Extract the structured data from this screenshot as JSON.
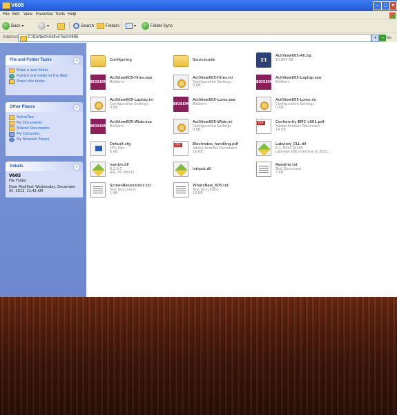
{
  "window": {
    "title": "V605"
  },
  "menu": [
    "File",
    "Edit",
    "View",
    "Favorites",
    "Tools",
    "Help"
  ],
  "toolbar": {
    "back": "Back",
    "search": "Search",
    "folders": "Folders",
    "folder_sync": "Folder Sync"
  },
  "address": {
    "label": "Address",
    "path": "C:\\Cortech\\ActiveTwo\\V605",
    "go": "Go"
  },
  "file_tasks": {
    "title": "File and Folder Tasks",
    "items": [
      "Make a new folder",
      "Publish this folder to the Web",
      "Share this folder"
    ]
  },
  "other_places": {
    "title": "Other Places",
    "items": [
      "ActiveTwo",
      "My Documents",
      "Shared Documents",
      "My Computer",
      "My Network Places"
    ]
  },
  "details": {
    "title": "Details",
    "name": "V605",
    "type": "File Folder",
    "modified": "Date Modified: Wednesday, December 05, 2012, 11:42 AM"
  },
  "files": [
    {
      "name": "Configuring",
      "kind": "folder"
    },
    {
      "name": "Sourcecode",
      "kind": "folder"
    },
    {
      "name": "ActiView605-All.zip",
      "kind": "zip",
      "line2": "10,894 KB"
    },
    {
      "name": "ActiView605-Hires.exe",
      "kind": "biosemi",
      "line2": "BioSemi"
    },
    {
      "name": "ActiView605-Hires.ini",
      "kind": "ini",
      "line2": "Configuration Settings",
      "line3": "0 KB"
    },
    {
      "name": "ActiView605-Laptop.exe",
      "kind": "biosemi",
      "line2": "BioSemi"
    },
    {
      "name": "ActiView605-Laptop.ini",
      "kind": "ini",
      "line2": "Configuration Settings",
      "line3": "0 KB"
    },
    {
      "name": "ActiView605-Lores.exe",
      "kind": "biosemi",
      "line2": "BioSemi"
    },
    {
      "name": "ActiView605-Lores.ini",
      "kind": "ini",
      "line2": "Configuration Settings",
      "line3": "0 KB"
    },
    {
      "name": "ActiView605-Wide.exe",
      "kind": "biosemi",
      "line2": "BioSemi"
    },
    {
      "name": "ActiView605-Wide.ini",
      "kind": "ini",
      "line2": "Configuration Settings",
      "line3": "0 KB"
    },
    {
      "name": "Conformity-EMC v601.pdf",
      "kind": "pdf",
      "line2": "Adobe Acrobat Document",
      "line3": "14 KB"
    },
    {
      "name": "Default.cfg",
      "kind": "cfg",
      "line2": "CFG File",
      "line3": "6 KB"
    },
    {
      "name": "Electrodes_handling.pdf",
      "kind": "pdf",
      "line2": "Adobe Acrobat Document",
      "line3": "19 KB"
    },
    {
      "name": "Labview_DLL.dll",
      "kind": "dll",
      "line2": "6.1.7600.16385",
      "line3": "Labview x86 interface to BioS..."
    },
    {
      "name": "lvanlys.dll",
      "kind": "dll",
      "line2": "8.2.0.0",
      "line3": "AAL for Win32"
    },
    {
      "name": "lvinput.dll",
      "kind": "dll"
    },
    {
      "name": "Readme.txt",
      "kind": "txt",
      "line2": "Text Document",
      "line3": "3 KB"
    },
    {
      "name": "ScreenResolutions.txt",
      "kind": "txt",
      "line2": "Text Document",
      "line3": "1 KB"
    },
    {
      "name": "WhatsNew_605.txt",
      "kind": "txt",
      "line2": "Text Document",
      "line3": "12 KB"
    }
  ]
}
